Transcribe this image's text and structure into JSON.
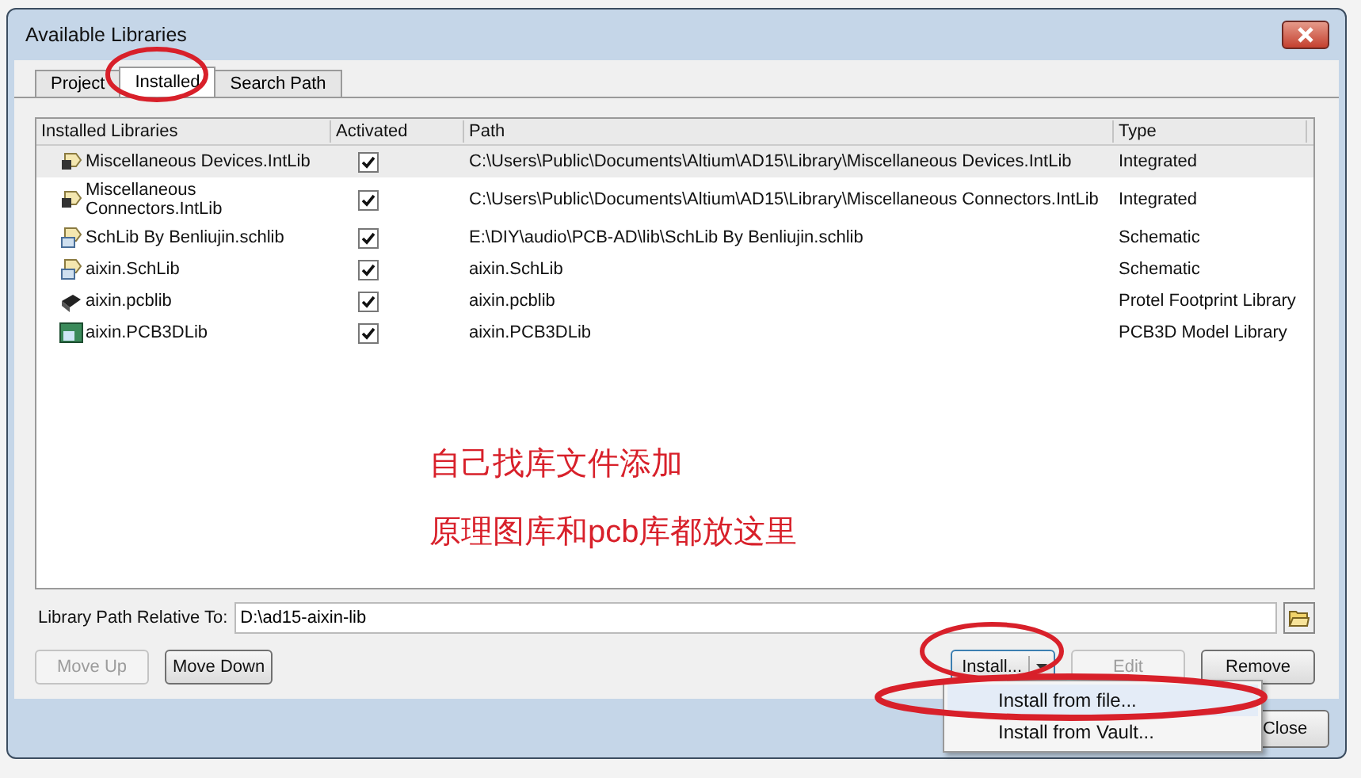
{
  "window": {
    "title": "Available Libraries"
  },
  "tabs": [
    {
      "label": "Project",
      "selected": false
    },
    {
      "label": "Installed",
      "selected": true
    },
    {
      "label": "Search Path",
      "selected": false
    }
  ],
  "table": {
    "columns": [
      "Installed Libraries",
      "Activated",
      "Path",
      "Type"
    ],
    "rows": [
      {
        "kind": "integrated",
        "name": "Miscellaneous Devices.IntLib",
        "activated": true,
        "path": "C:\\Users\\Public\\Documents\\Altium\\AD15\\Library\\Miscellaneous Devices.IntLib",
        "type": "Integrated",
        "selected": true
      },
      {
        "kind": "integrated",
        "name": "Miscellaneous Connectors.IntLib",
        "activated": true,
        "path": "C:\\Users\\Public\\Documents\\Altium\\AD15\\Library\\Miscellaneous Connectors.IntLib",
        "type": "Integrated",
        "selected": false
      },
      {
        "kind": "schematic",
        "name": "SchLib By Benliujin.schlib",
        "activated": true,
        "path": "E:\\DIY\\audio\\PCB-AD\\lib\\SchLib By Benliujin.schlib",
        "type": "Schematic",
        "selected": false
      },
      {
        "kind": "schematic",
        "name": "aixin.SchLib",
        "activated": true,
        "path": "aixin.SchLib",
        "type": "Schematic",
        "selected": false
      },
      {
        "kind": "footprint",
        "name": "aixin.pcblib",
        "activated": true,
        "path": "aixin.pcblib",
        "type": "Protel Footprint Library",
        "selected": false
      },
      {
        "kind": "model3d",
        "name": "aixin.PCB3DLib",
        "activated": true,
        "path": "aixin.PCB3DLib",
        "type": "PCB3D Model Library",
        "selected": false
      }
    ]
  },
  "annotation_notes": [
    "自己找库文件添加",
    "原理图库和pcb库都放这里"
  ],
  "library_path": {
    "label": "Library Path Relative To:",
    "value": "D:\\ad15-aixin-lib"
  },
  "left_buttons": [
    {
      "label": "Move Up",
      "disabled": true
    },
    {
      "label": "Move Down",
      "disabled": false
    }
  ],
  "right_buttons": [
    {
      "kind": "split",
      "label": "Install...",
      "disabled": false
    },
    {
      "kind": "plain",
      "label": "Edit",
      "disabled": true
    },
    {
      "kind": "plain",
      "label": "Remove",
      "disabled": false
    }
  ],
  "close_button": "Close",
  "install_menu": [
    {
      "label": "Install from file...",
      "selected": true
    },
    {
      "label": "Install from Vault...",
      "selected": false
    }
  ]
}
